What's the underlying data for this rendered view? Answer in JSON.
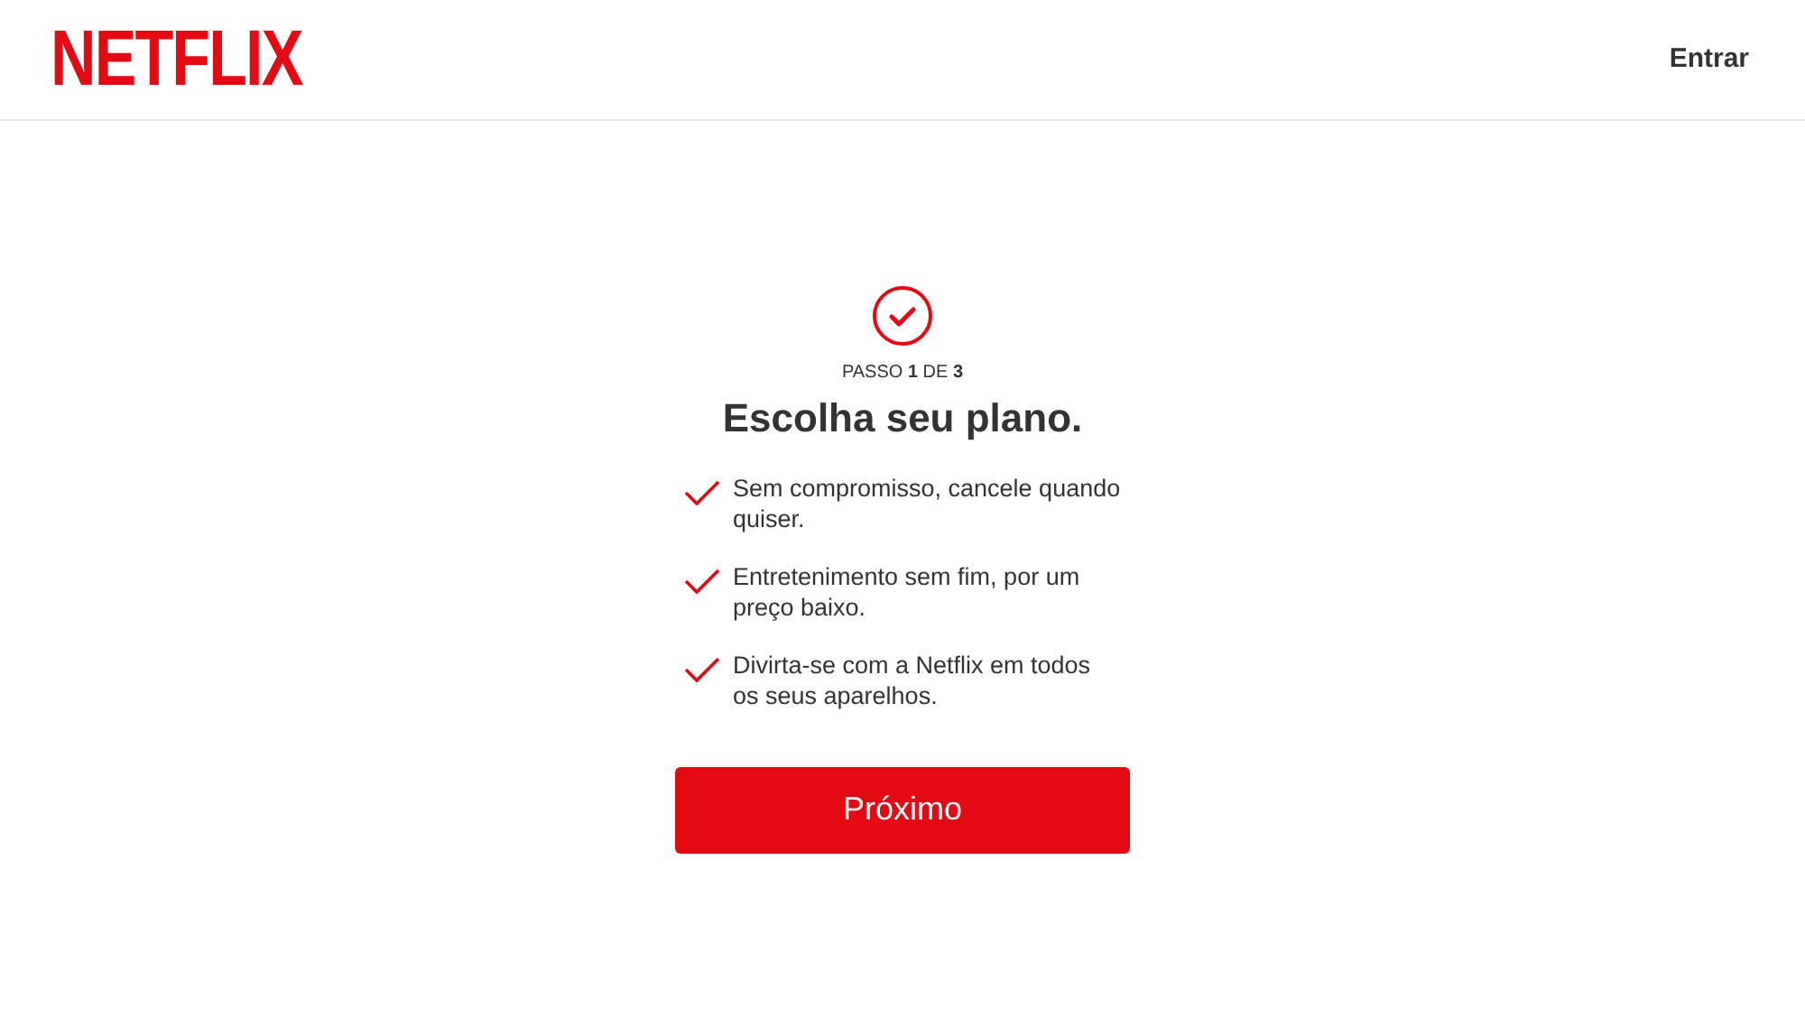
{
  "header": {
    "logo": "NETFLIX",
    "sign_in": "Entrar"
  },
  "step": {
    "label": "PASSO **1** DE **3**",
    "title": "Escolha seu plano."
  },
  "benefits": [
    "Sem compromisso, cancele quando quiser.",
    "Entretenimento sem fim, por um preço baixo.",
    "Divirta-se com a Netflix em todos os seus aparelhos."
  ],
  "next_button": "Próximo"
}
